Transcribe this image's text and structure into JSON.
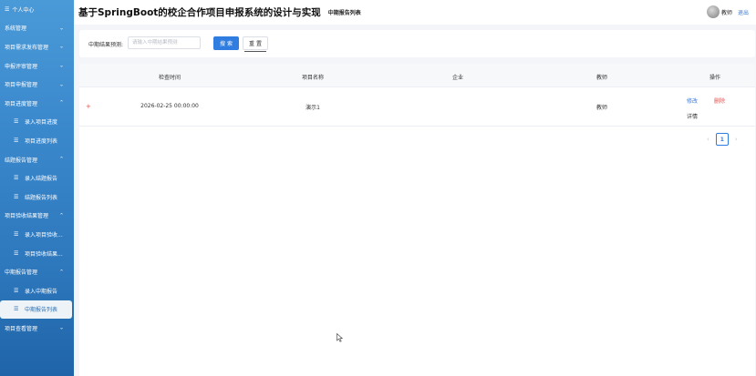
{
  "sidebar": {
    "items": [
      {
        "label": "个人中心",
        "type": "top",
        "icon": "menu-lines-icon"
      },
      {
        "label": "系统管理",
        "type": "group",
        "chevron": "down"
      },
      {
        "label": "项目需求发布管理",
        "type": "group",
        "chevron": "down"
      },
      {
        "label": "申报评审管理",
        "type": "group",
        "chevron": "down"
      },
      {
        "label": "项目申报管理",
        "type": "group",
        "chevron": "down"
      },
      {
        "label": "项目进度管理",
        "type": "group",
        "chevron": "up"
      },
      {
        "label": "录入项目进度",
        "type": "sub"
      },
      {
        "label": "项目进度列表",
        "type": "sub"
      },
      {
        "label": "结题报告管理",
        "type": "group",
        "chevron": "up"
      },
      {
        "label": "录入结题报告",
        "type": "sub"
      },
      {
        "label": "结题报告列表",
        "type": "sub"
      },
      {
        "label": "项目验收结果管理",
        "type": "group",
        "chevron": "up"
      },
      {
        "label": "录入项目验收...",
        "type": "sub"
      },
      {
        "label": "项目验收结果...",
        "type": "sub"
      },
      {
        "label": "中期报告管理",
        "type": "group",
        "chevron": "up"
      },
      {
        "label": "录入中期报告",
        "type": "sub"
      },
      {
        "label": "中期报告列表",
        "type": "sub",
        "active": true
      },
      {
        "label": "项目查看管理",
        "type": "group",
        "chevron": "down"
      }
    ]
  },
  "header": {
    "title": "基于SpringBoot的校企合作项目申报系统的设计与实现",
    "breadcrumb": "中期报告列表",
    "user_name": "教师",
    "logout": "退出"
  },
  "search": {
    "label": "中期结果预测:",
    "placeholder": "请输入中期结果预测",
    "search_button": "搜 索",
    "reset_button": "重 置"
  },
  "table": {
    "columns": [
      "检查时间",
      "项目名称",
      "企业",
      "教师",
      "操作"
    ],
    "rows": [
      {
        "expand": "+",
        "check_time": "2026-02-25 00:00:00",
        "project_name": "演示1",
        "company": "",
        "teacher": "教师",
        "edit": "修改",
        "delete": "删除",
        "detail": "详情"
      }
    ]
  },
  "pagination": {
    "prev": "‹",
    "current": "1",
    "next": "›"
  },
  "colors": {
    "primary": "#2f7de1",
    "danger": "#e05050",
    "sidebar_top": "#4a9ad8",
    "sidebar_bottom": "#1f64a8"
  }
}
